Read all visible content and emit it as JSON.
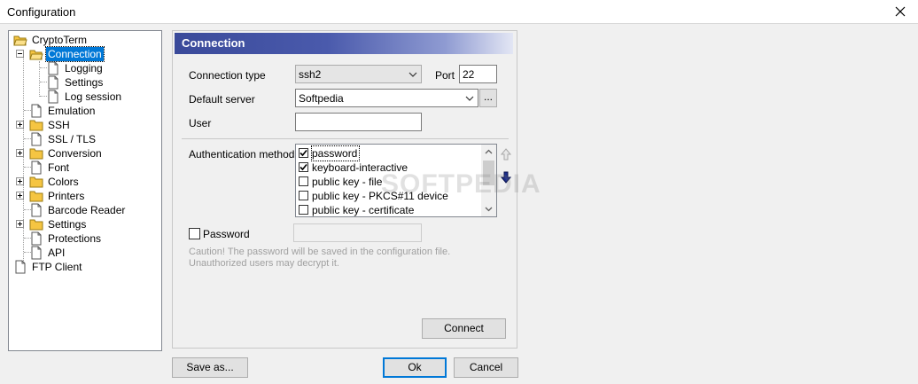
{
  "window": {
    "title": "Configuration"
  },
  "tree": {
    "root": "CryptoTerm",
    "items": [
      {
        "label": "Connection"
      },
      {
        "label": "Logging"
      },
      {
        "label": "Settings"
      },
      {
        "label": "Log session"
      },
      {
        "label": "Emulation"
      },
      {
        "label": "SSH"
      },
      {
        "label": "SSL / TLS"
      },
      {
        "label": "Conversion"
      },
      {
        "label": "Font"
      },
      {
        "label": "Colors"
      },
      {
        "label": "Printers"
      },
      {
        "label": "Barcode Reader"
      },
      {
        "label": "Settings"
      },
      {
        "label": "Protections"
      },
      {
        "label": "API"
      }
    ],
    "second_root": "FTP Client",
    "selected": "Connection"
  },
  "panel": {
    "header": "Connection",
    "connection_type_label": "Connection type",
    "connection_type_value": "ssh2",
    "port_label": "Port",
    "port_value": "22",
    "default_server_label": "Default server",
    "default_server_value": "Softpedia",
    "browse_label": "...",
    "user_label": "User",
    "user_value": "",
    "auth_label": "Authentication method",
    "auth_methods": [
      {
        "label": "password",
        "checked": true
      },
      {
        "label": "keyboard-interactive",
        "checked": true
      },
      {
        "label": "public key - file",
        "checked": false
      },
      {
        "label": "public key - PKCS#11 device",
        "checked": false
      },
      {
        "label": "public key - certificate",
        "checked": false
      }
    ],
    "password_label": "Password",
    "password_checked": false,
    "caution_line1": "Caution! The password will be saved in the configuration file.",
    "caution_line2": "Unauthorized users may decrypt it.",
    "connect_label": "Connect",
    "watermark": "SOFTPEDIA"
  },
  "footer": {
    "save_as": "Save as...",
    "ok": "Ok",
    "cancel": "Cancel"
  },
  "colors": {
    "header_start": "#3a4a9a",
    "selection": "#0078d7",
    "folder": "#f5c542"
  }
}
